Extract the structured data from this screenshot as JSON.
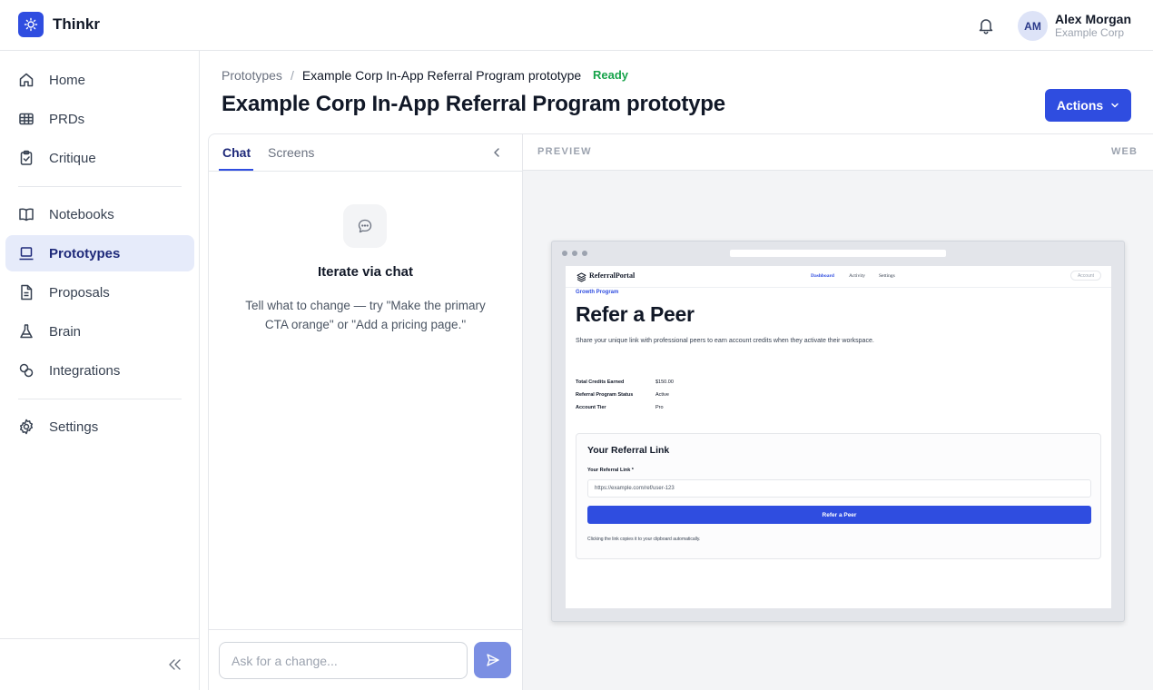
{
  "app": {
    "name": "Thinkr"
  },
  "user": {
    "initials": "AM",
    "name": "Alex Morgan",
    "org": "Example Corp"
  },
  "sidebar": {
    "items": [
      {
        "label": "Home",
        "icon": "home-icon"
      },
      {
        "label": "PRDs",
        "icon": "table-icon"
      },
      {
        "label": "Critique",
        "icon": "clipboard-check-icon"
      },
      {
        "label": "Notebooks",
        "icon": "book-open-icon"
      },
      {
        "label": "Prototypes",
        "icon": "laptop-icon",
        "active": true
      },
      {
        "label": "Proposals",
        "icon": "document-icon"
      },
      {
        "label": "Brain",
        "icon": "flask-icon"
      },
      {
        "label": "Integrations",
        "icon": "link-icon"
      },
      {
        "label": "Settings",
        "icon": "gear-icon"
      }
    ]
  },
  "header": {
    "breadcrumb_parent": "Prototypes",
    "breadcrumb_sep": "/",
    "breadcrumb_current": "Example Corp In-App Referral Program prototype",
    "status": "Ready",
    "title": "Example Corp In-App Referral Program prototype",
    "actions_label": "Actions"
  },
  "chat": {
    "tabs": [
      {
        "label": "Chat",
        "active": true
      },
      {
        "label": "Screens",
        "active": false
      }
    ],
    "empty_title": "Iterate via chat",
    "empty_desc": "Tell what to change — try \"Make the primary CTA orange\" or \"Add a pricing page.\"",
    "input_placeholder": "Ask for a change..."
  },
  "preview": {
    "label": "PREVIEW",
    "mode": "WEB",
    "site": {
      "brand": "ReferralPortal",
      "nav": [
        {
          "label": "Dashboard",
          "active": true
        },
        {
          "label": "Activity"
        },
        {
          "label": "Settings"
        }
      ],
      "account_label": "Account",
      "eyebrow": "Growth Program",
      "heading": "Refer a Peer",
      "description": "Share your unique link with professional peers to earn account credits when they activate their workspace.",
      "stats": [
        {
          "label": "Total Credits Earned",
          "value": "$150.00"
        },
        {
          "label": "Referral Program Status",
          "value": "Active"
        },
        {
          "label": "Account Tier",
          "value": "Pro"
        }
      ],
      "card": {
        "title": "Your Referral Link",
        "field_label": "Your Referral Link *",
        "field_value": "https://example.com/ref/user-123",
        "button_label": "Refer a Peer",
        "hint": "Clicking the link copies it to your clipboard automatically."
      }
    }
  },
  "colors": {
    "accent": "#2f4de0",
    "status_ready": "#16a34a",
    "active_nav_bg": "#e6ebfa"
  }
}
